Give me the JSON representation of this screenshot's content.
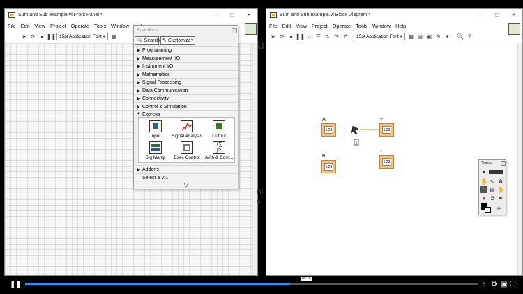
{
  "front_panel": {
    "title": "Sum and Sub example.vi Front Panel *",
    "menu": [
      "File",
      "Edit",
      "View",
      "Project",
      "Operate",
      "Tools",
      "Window",
      "Help"
    ],
    "font": "15pt Application Font",
    "side_text": [
      "ol",
      "s"
    ]
  },
  "functions_palette": {
    "title": "Functions",
    "search_label": "Search",
    "customize_label": "Customize",
    "categories": [
      "Programming",
      "Measurement I/O",
      "Instrument I/O",
      "Mathematics",
      "Signal Processing",
      "Data Communication",
      "Connectivity",
      "Control & Simulation",
      "Express"
    ],
    "express_items": [
      "Input",
      "Signal Analysis",
      "Output",
      "Sig Manip",
      "Exec Control",
      "Arith & Com..."
    ],
    "after": [
      "Addons",
      "Select a VI..."
    ]
  },
  "block_diagram": {
    "title": "Sum and Sub example.vi Block Diagram *",
    "menu": [
      "File",
      "Edit",
      "View",
      "Project",
      "Operate",
      "Tools",
      "Window",
      "Help"
    ],
    "font": "15pt Application Font",
    "partial_text": "a",
    "nodes": {
      "a_label": "A",
      "b_label": "B",
      "plus_label": "+",
      "minus_label": "-",
      "value": "1.23"
    }
  },
  "tools_palette": {
    "title": "Tools"
  },
  "video": {
    "timestamp": "05:18",
    "progress": 0.585
  },
  "colors": {
    "terminal_orange": "#f7c47c",
    "progress_blue": "#1e90ff"
  }
}
